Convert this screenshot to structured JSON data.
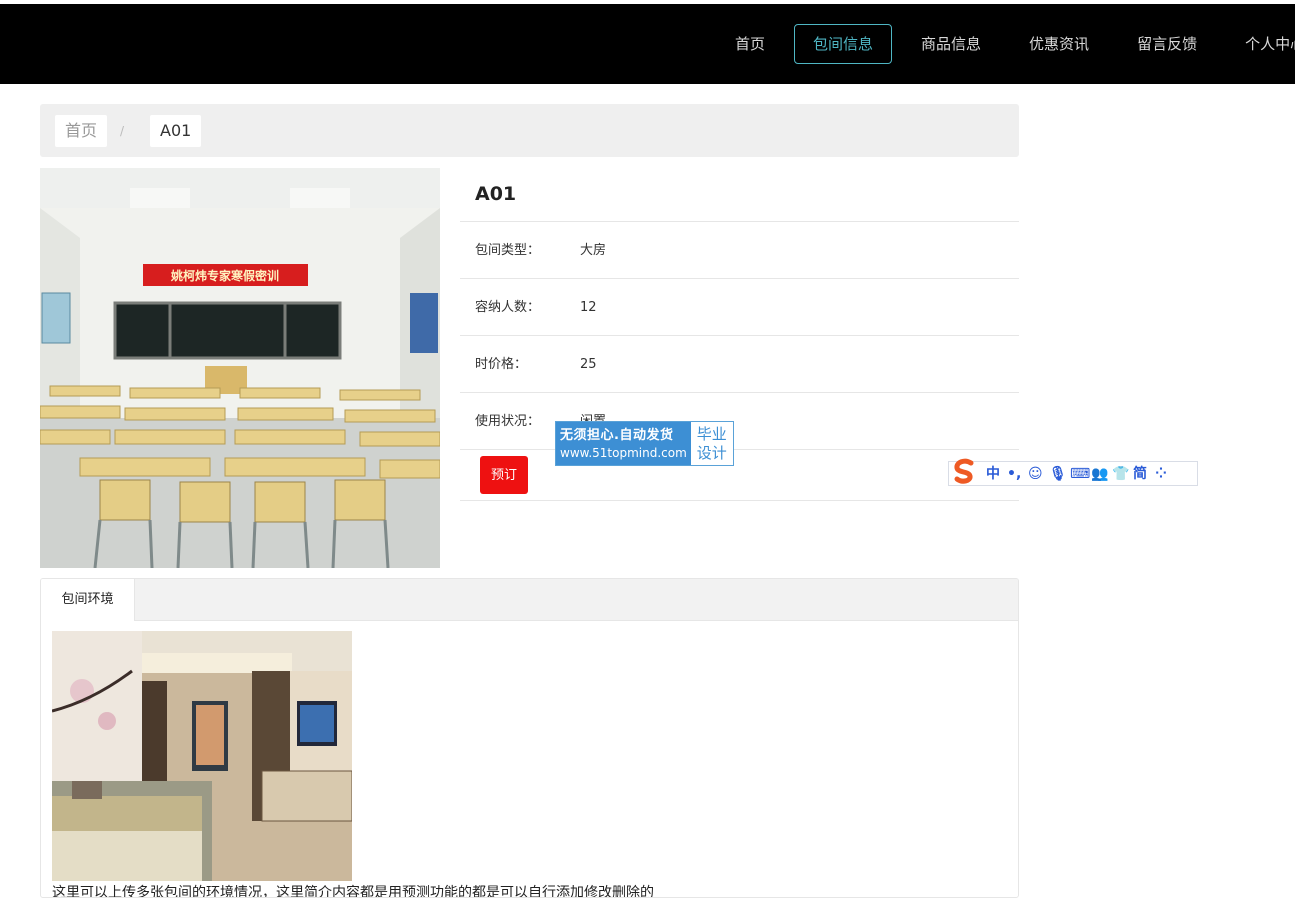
{
  "nav": {
    "items": [
      {
        "label": "首页",
        "active": false
      },
      {
        "label": "包间信息",
        "active": true
      },
      {
        "label": "商品信息",
        "active": false
      },
      {
        "label": "优惠资讯",
        "active": false
      },
      {
        "label": "留言反馈",
        "active": false
      },
      {
        "label": "个人中心",
        "active": false
      }
    ]
  },
  "breadcrumb": {
    "home": "首页",
    "separator": "/",
    "current": "A01"
  },
  "room": {
    "name": "A01",
    "type_label": "包间类型：",
    "type_value": "大房",
    "capacity_label": "容纳人数：",
    "capacity_value": "12",
    "price_label": "时价格：",
    "price_value": "25",
    "status_label": "使用状况：",
    "status_value": "闲置",
    "book_label": "预订",
    "banner_text": "姚柯炜专家寒假密训"
  },
  "watermark": {
    "line1": "无须担心.自动发货",
    "line2": "www.51topmind.com",
    "right1": "毕业",
    "right2": "设计"
  },
  "ime": {
    "items": [
      "中",
      "•,",
      "☺",
      "🎙",
      "⌨",
      "👥",
      "👕",
      "简",
      "⁘"
    ]
  },
  "tabs": {
    "active": "包间环境",
    "description": "这里可以上传多张包间的环境情况，这里简介内容都是用预测功能的都是可以自行添加修改删除的"
  },
  "colors": {
    "accent": "#4fb6c4",
    "book_button": "#ee1111",
    "topbar": "#000000"
  }
}
